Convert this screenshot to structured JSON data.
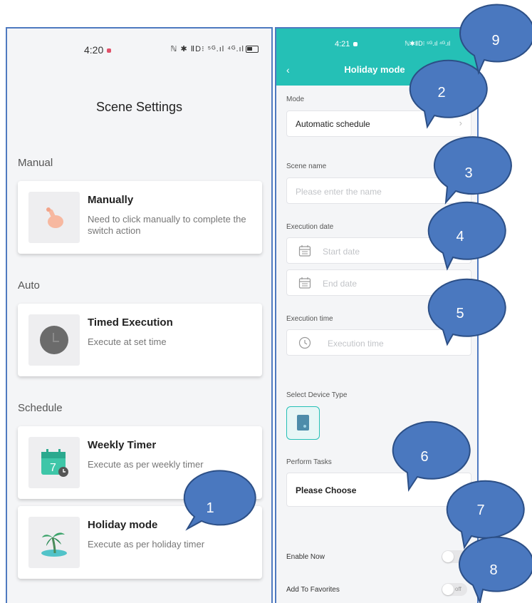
{
  "left_screen": {
    "status_time": "4:20",
    "status_icons": "ℕ ✱ ⅡD⁝ ⁵ᴳ.ıl ⁴ᴳ.ıl",
    "title": "Scene Settings",
    "sections": [
      {
        "label": "Manual",
        "cards": [
          {
            "icon": "hand-tap-icon",
            "title": "Manually",
            "desc": "Need to click manually to complete the switch action"
          }
        ]
      },
      {
        "label": "Auto",
        "cards": [
          {
            "icon": "clock-icon",
            "title": "Timed Execution",
            "desc": "Execute at set time"
          }
        ]
      },
      {
        "label": "Schedule",
        "cards": [
          {
            "icon": "calendar-icon",
            "title": "Weekly Timer",
            "desc": "Execute as per weekly timer",
            "icon_text": "7"
          },
          {
            "icon": "palm-tree-icon",
            "title": "Holiday mode",
            "desc": "Execute as per holiday timer"
          }
        ]
      }
    ]
  },
  "right_screen": {
    "status_time": "4:21",
    "status_icons": "ℕ✱ⅡD⁝ ⁵ᴳ.ıl ⁴ᴳ.ıl",
    "back_icon": "chevron-left-icon",
    "title": "Holiday mode",
    "mode": {
      "label": "Mode",
      "value": "Automatic schedule"
    },
    "scene_name": {
      "label": "Scene name",
      "placeholder": "Please enter the name"
    },
    "execution_date": {
      "label": "Execution date",
      "start_placeholder": "Start date",
      "end_placeholder": "End date"
    },
    "execution_time": {
      "label": "Execution time",
      "placeholder": "Execution time"
    },
    "device_type": {
      "label": "Select Device Type",
      "icon": "switch-device-icon"
    },
    "perform_tasks": {
      "label": "Perform Tasks",
      "value": "Please Choose"
    },
    "enable_now": {
      "label": "Enable Now",
      "state": "off"
    },
    "add_favorites": {
      "label": "Add To Favorites",
      "state": "off",
      "toggle_text": "off"
    }
  },
  "callouts": [
    "1",
    "2",
    "3",
    "4",
    "5",
    "6",
    "7",
    "8",
    "9"
  ],
  "colors": {
    "accent_teal": "#25c0b6",
    "callout_fill": "#4a78bf",
    "callout_stroke": "#2c4f86",
    "frame_border": "#4f7ac0"
  }
}
